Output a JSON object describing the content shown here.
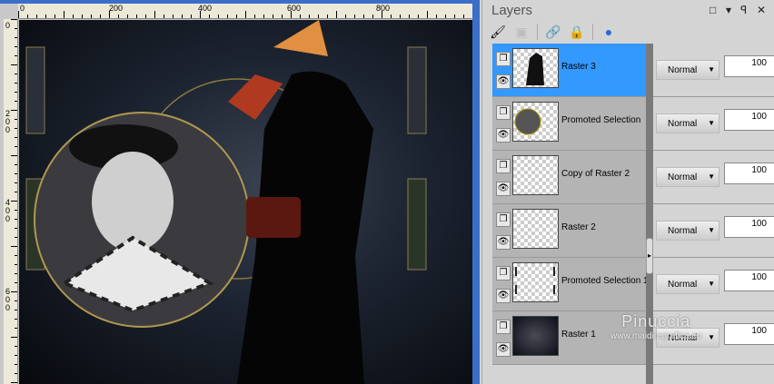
{
  "ruler": {
    "top_labels": [
      "0",
      "200",
      "400",
      "600",
      "800"
    ],
    "left_labels": [
      "0",
      "200",
      "400",
      "600"
    ]
  },
  "panel": {
    "title": "Layers",
    "buttons": {
      "restore": "□",
      "menu": "▾",
      "pin": "ꟼ",
      "close": "✕"
    }
  },
  "toolbar": {
    "icons": [
      "new-raster-layer-icon",
      "new-mask-layer-icon",
      "link-icon",
      "lock-icon",
      "layer-effects-icon"
    ]
  },
  "layers": [
    {
      "name": "Raster 3",
      "blend": "Normal",
      "opacity": "100",
      "selected": true
    },
    {
      "name": "Promoted Selection",
      "blend": "Normal",
      "opacity": "100"
    },
    {
      "name": "Copy of Raster 2",
      "blend": "Normal",
      "opacity": "100"
    },
    {
      "name": "Raster 2",
      "blend": "Normal",
      "opacity": "100"
    },
    {
      "name": "Promoted Selection 1",
      "blend": "Normal",
      "opacity": "100"
    },
    {
      "name": "Raster 1",
      "blend": "Normal",
      "opacity": "100"
    }
  ],
  "watermark": {
    "name": "Pinuccia",
    "url": "www.maidiregrafica.eu"
  },
  "colors": {
    "selection": "#3399ff",
    "title_bar": "#3a6ec8"
  }
}
